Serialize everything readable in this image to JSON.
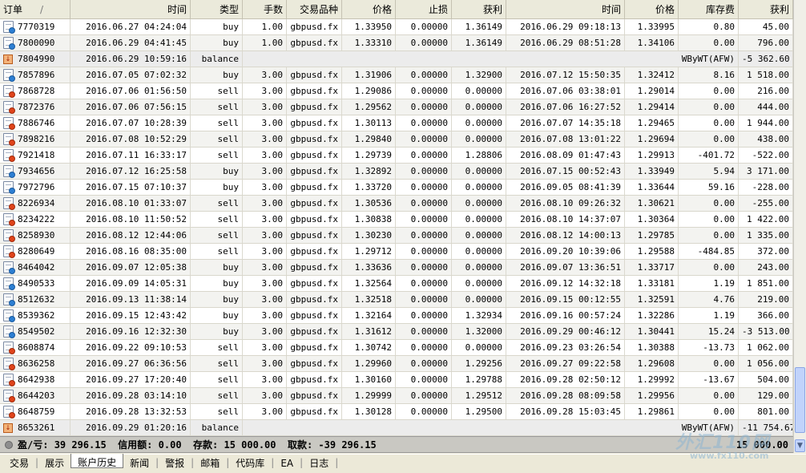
{
  "columns": [
    {
      "key": "order",
      "label": "订单",
      "width": 88,
      "align": "left"
    },
    {
      "key": "open_time",
      "label": "时间",
      "width": 150
    },
    {
      "key": "type",
      "label": "类型",
      "width": 65
    },
    {
      "key": "size",
      "label": "手数",
      "width": 55
    },
    {
      "key": "symbol",
      "label": "交易品种",
      "width": 69
    },
    {
      "key": "open_price",
      "label": "价格",
      "width": 67
    },
    {
      "key": "sl",
      "label": "止损",
      "width": 70
    },
    {
      "key": "tp",
      "label": "获利",
      "width": 68
    },
    {
      "key": "close_time",
      "label": "时间",
      "width": 148
    },
    {
      "key": "close_price",
      "label": "价格",
      "width": 67
    },
    {
      "key": "swap",
      "label": "库存费",
      "width": 75
    },
    {
      "key": "profit",
      "label": "获利",
      "width": 68
    }
  ],
  "sort_indicator": "/",
  "rows": [
    {
      "kind": "buy",
      "order": "7770319",
      "open_time": "2016.06.27 04:24:04",
      "type": "buy",
      "size": "1.00",
      "symbol": "gbpusd.fx",
      "open_price": "1.33950",
      "sl": "0.00000",
      "tp": "1.36149",
      "close_time": "2016.06.29 09:18:13",
      "close_price": "1.33995",
      "swap": "0.80",
      "profit": "45.00"
    },
    {
      "kind": "buy",
      "order": "7800090",
      "open_time": "2016.06.29 04:41:45",
      "type": "buy",
      "size": "1.00",
      "symbol": "gbpusd.fx",
      "open_price": "1.33310",
      "sl": "0.00000",
      "tp": "1.36149",
      "close_time": "2016.06.29 08:51:28",
      "close_price": "1.34106",
      "swap": "0.00",
      "profit": "796.00"
    },
    {
      "kind": "balance",
      "order": "7804990",
      "open_time": "2016.06.29 10:59:16",
      "type": "balance",
      "comment": "WByWT(AFW)",
      "profit": "-5 362.60"
    },
    {
      "kind": "buy",
      "order": "7857896",
      "open_time": "2016.07.05 07:02:32",
      "type": "buy",
      "size": "3.00",
      "symbol": "gbpusd.fx",
      "open_price": "1.31906",
      "sl": "0.00000",
      "tp": "1.32900",
      "close_time": "2016.07.12 15:50:35",
      "close_price": "1.32412",
      "swap": "8.16",
      "profit": "1 518.00"
    },
    {
      "kind": "sell",
      "order": "7868728",
      "open_time": "2016.07.06 01:56:50",
      "type": "sell",
      "size": "3.00",
      "symbol": "gbpusd.fx",
      "open_price": "1.29086",
      "sl": "0.00000",
      "tp": "0.00000",
      "close_time": "2016.07.06 03:38:01",
      "close_price": "1.29014",
      "swap": "0.00",
      "profit": "216.00"
    },
    {
      "kind": "sell",
      "order": "7872376",
      "open_time": "2016.07.06 07:56:15",
      "type": "sell",
      "size": "3.00",
      "symbol": "gbpusd.fx",
      "open_price": "1.29562",
      "sl": "0.00000",
      "tp": "0.00000",
      "close_time": "2016.07.06 16:27:52",
      "close_price": "1.29414",
      "swap": "0.00",
      "profit": "444.00"
    },
    {
      "kind": "sell",
      "order": "7886746",
      "open_time": "2016.07.07 10:28:39",
      "type": "sell",
      "size": "3.00",
      "symbol": "gbpusd.fx",
      "open_price": "1.30113",
      "sl": "0.00000",
      "tp": "0.00000",
      "close_time": "2016.07.07 14:35:18",
      "close_price": "1.29465",
      "swap": "0.00",
      "profit": "1 944.00"
    },
    {
      "kind": "sell",
      "order": "7898216",
      "open_time": "2016.07.08 10:52:29",
      "type": "sell",
      "size": "3.00",
      "symbol": "gbpusd.fx",
      "open_price": "1.29840",
      "sl": "0.00000",
      "tp": "0.00000",
      "close_time": "2016.07.08 13:01:22",
      "close_price": "1.29694",
      "swap": "0.00",
      "profit": "438.00"
    },
    {
      "kind": "sell",
      "order": "7921418",
      "open_time": "2016.07.11 16:33:17",
      "type": "sell",
      "size": "3.00",
      "symbol": "gbpusd.fx",
      "open_price": "1.29739",
      "sl": "0.00000",
      "tp": "1.28806",
      "close_time": "2016.08.09 01:47:43",
      "close_price": "1.29913",
      "swap": "-401.72",
      "profit": "-522.00"
    },
    {
      "kind": "buy",
      "order": "7934656",
      "open_time": "2016.07.12 16:25:58",
      "type": "buy",
      "size": "3.00",
      "symbol": "gbpusd.fx",
      "open_price": "1.32892",
      "sl": "0.00000",
      "tp": "0.00000",
      "close_time": "2016.07.15 00:52:43",
      "close_price": "1.33949",
      "swap": "5.94",
      "profit": "3 171.00"
    },
    {
      "kind": "buy",
      "order": "7972796",
      "open_time": "2016.07.15 07:10:37",
      "type": "buy",
      "size": "3.00",
      "symbol": "gbpusd.fx",
      "open_price": "1.33720",
      "sl": "0.00000",
      "tp": "0.00000",
      "close_time": "2016.09.05 08:41:39",
      "close_price": "1.33644",
      "swap": "59.16",
      "profit": "-228.00"
    },
    {
      "kind": "sell",
      "order": "8226934",
      "open_time": "2016.08.10 01:33:07",
      "type": "sell",
      "size": "3.00",
      "symbol": "gbpusd.fx",
      "open_price": "1.30536",
      "sl": "0.00000",
      "tp": "0.00000",
      "close_time": "2016.08.10 09:26:32",
      "close_price": "1.30621",
      "swap": "0.00",
      "profit": "-255.00"
    },
    {
      "kind": "sell",
      "order": "8234222",
      "open_time": "2016.08.10 11:50:52",
      "type": "sell",
      "size": "3.00",
      "symbol": "gbpusd.fx",
      "open_price": "1.30838",
      "sl": "0.00000",
      "tp": "0.00000",
      "close_time": "2016.08.10 14:37:07",
      "close_price": "1.30364",
      "swap": "0.00",
      "profit": "1 422.00"
    },
    {
      "kind": "sell",
      "order": "8258930",
      "open_time": "2016.08.12 12:44:06",
      "type": "sell",
      "size": "3.00",
      "symbol": "gbpusd.fx",
      "open_price": "1.30230",
      "sl": "0.00000",
      "tp": "0.00000",
      "close_time": "2016.08.12 14:00:13",
      "close_price": "1.29785",
      "swap": "0.00",
      "profit": "1 335.00"
    },
    {
      "kind": "sell",
      "order": "8280649",
      "open_time": "2016.08.16 08:35:00",
      "type": "sell",
      "size": "3.00",
      "symbol": "gbpusd.fx",
      "open_price": "1.29712",
      "sl": "0.00000",
      "tp": "0.00000",
      "close_time": "2016.09.20 10:39:06",
      "close_price": "1.29588",
      "swap": "-484.85",
      "profit": "372.00"
    },
    {
      "kind": "buy",
      "order": "8464042",
      "open_time": "2016.09.07 12:05:38",
      "type": "buy",
      "size": "3.00",
      "symbol": "gbpusd.fx",
      "open_price": "1.33636",
      "sl": "0.00000",
      "tp": "0.00000",
      "close_time": "2016.09.07 13:36:51",
      "close_price": "1.33717",
      "swap": "0.00",
      "profit": "243.00"
    },
    {
      "kind": "buy",
      "order": "8490533",
      "open_time": "2016.09.09 14:05:31",
      "type": "buy",
      "size": "3.00",
      "symbol": "gbpusd.fx",
      "open_price": "1.32564",
      "sl": "0.00000",
      "tp": "0.00000",
      "close_time": "2016.09.12 14:32:18",
      "close_price": "1.33181",
      "swap": "1.19",
      "profit": "1 851.00"
    },
    {
      "kind": "buy",
      "order": "8512632",
      "open_time": "2016.09.13 11:38:14",
      "type": "buy",
      "size": "3.00",
      "symbol": "gbpusd.fx",
      "open_price": "1.32518",
      "sl": "0.00000",
      "tp": "0.00000",
      "close_time": "2016.09.15 00:12:55",
      "close_price": "1.32591",
      "swap": "4.76",
      "profit": "219.00"
    },
    {
      "kind": "buy",
      "order": "8539362",
      "open_time": "2016.09.15 12:43:42",
      "type": "buy",
      "size": "3.00",
      "symbol": "gbpusd.fx",
      "open_price": "1.32164",
      "sl": "0.00000",
      "tp": "1.32934",
      "close_time": "2016.09.16 00:57:24",
      "close_price": "1.32286",
      "swap": "1.19",
      "profit": "366.00"
    },
    {
      "kind": "buy",
      "order": "8549502",
      "open_time": "2016.09.16 12:32:30",
      "type": "buy",
      "size": "3.00",
      "symbol": "gbpusd.fx",
      "open_price": "1.31612",
      "sl": "0.00000",
      "tp": "1.32000",
      "close_time": "2016.09.29 00:46:12",
      "close_price": "1.30441",
      "swap": "15.24",
      "profit": "-3 513.00"
    },
    {
      "kind": "sell",
      "order": "8608874",
      "open_time": "2016.09.22 09:10:53",
      "type": "sell",
      "size": "3.00",
      "symbol": "gbpusd.fx",
      "open_price": "1.30742",
      "sl": "0.00000",
      "tp": "0.00000",
      "close_time": "2016.09.23 03:26:54",
      "close_price": "1.30388",
      "swap": "-13.73",
      "profit": "1 062.00"
    },
    {
      "kind": "sell",
      "order": "8636258",
      "open_time": "2016.09.27 06:36:56",
      "type": "sell",
      "size": "3.00",
      "symbol": "gbpusd.fx",
      "open_price": "1.29960",
      "sl": "0.00000",
      "tp": "1.29256",
      "close_time": "2016.09.27 09:22:58",
      "close_price": "1.29608",
      "swap": "0.00",
      "profit": "1 056.00"
    },
    {
      "kind": "sell",
      "order": "8642938",
      "open_time": "2016.09.27 17:20:40",
      "type": "sell",
      "size": "3.00",
      "symbol": "gbpusd.fx",
      "open_price": "1.30160",
      "sl": "0.00000",
      "tp": "1.29788",
      "close_time": "2016.09.28 02:50:12",
      "close_price": "1.29992",
      "swap": "-13.67",
      "profit": "504.00"
    },
    {
      "kind": "sell",
      "order": "8644203",
      "open_time": "2016.09.28 03:14:10",
      "type": "sell",
      "size": "3.00",
      "symbol": "gbpusd.fx",
      "open_price": "1.29999",
      "sl": "0.00000",
      "tp": "1.29512",
      "close_time": "2016.09.28 08:09:58",
      "close_price": "1.29956",
      "swap": "0.00",
      "profit": "129.00"
    },
    {
      "kind": "sell",
      "order": "8648759",
      "open_time": "2016.09.28 13:32:53",
      "type": "sell",
      "size": "3.00",
      "symbol": "gbpusd.fx",
      "open_price": "1.30128",
      "sl": "0.00000",
      "tp": "1.29500",
      "close_time": "2016.09.28 15:03:45",
      "close_price": "1.29861",
      "swap": "0.00",
      "profit": "801.00"
    },
    {
      "kind": "balance",
      "order": "8653261",
      "open_time": "2016.09.29 01:20:16",
      "type": "balance",
      "comment": "WByWT(AFW)",
      "profit": "-11 754.67"
    }
  ],
  "summary": {
    "pnl_label": "盈/亏:",
    "pnl_value": "39 296.15",
    "credit_label": "信用额:",
    "credit_value": "0.00",
    "deposit_label": "存款:",
    "deposit_value": "15 000.00",
    "withdraw_label": "取款:",
    "withdraw_value": "-39 296.15",
    "total": "15 000.00"
  },
  "tabs": [
    {
      "label": "交易",
      "active": false
    },
    {
      "label": "展示",
      "active": false
    },
    {
      "label": "账户历史",
      "active": true
    },
    {
      "label": "新闻",
      "active": false
    },
    {
      "label": "警报",
      "active": false
    },
    {
      "label": "邮箱",
      "active": false
    },
    {
      "label": "代码库",
      "active": false
    },
    {
      "label": "EA",
      "active": false
    },
    {
      "label": "日志",
      "active": false
    }
  ],
  "watermark": {
    "logo": "外汇110网",
    "url": "www.fx110.com"
  },
  "icons": {
    "buy": "buy-order-icon",
    "sell": "sell-order-icon",
    "balance": "balance-icon",
    "scroll_down": "chevron-down-icon"
  },
  "colors": {
    "buy_dot": "#2d7fd3",
    "sell_dot": "#e0441b",
    "summary_bg": "#c9c8c2",
    "scroll_thumb": "#c1d3fb"
  }
}
